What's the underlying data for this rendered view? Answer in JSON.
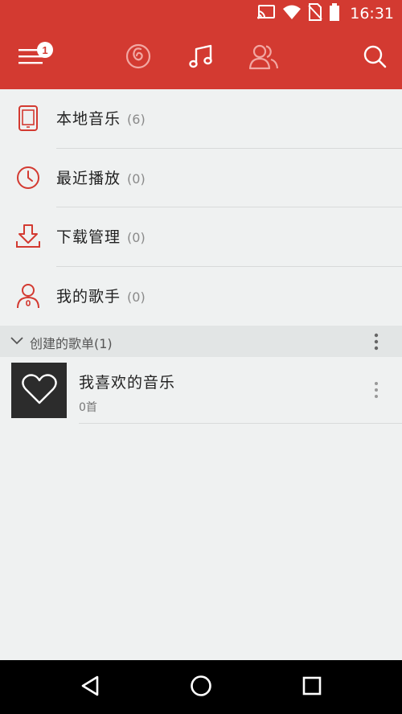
{
  "status_bar": {
    "time": "16:31",
    "icons": [
      "cast-icon",
      "wifi-icon",
      "no-sim-icon",
      "battery-icon"
    ]
  },
  "toolbar": {
    "menu_badge": "1",
    "tabs": [
      "netease-music-logo-icon",
      "music-note-icon",
      "friends-icon"
    ],
    "active_tab": "music-note-icon",
    "colors": {
      "bar": "#d33a31",
      "icon": "#ffffff",
      "icon_dim": "#f2a7a2"
    }
  },
  "menu": [
    {
      "icon": "phone-icon",
      "label": "本地音乐",
      "count": "(6)"
    },
    {
      "icon": "clock-icon",
      "label": "最近播放",
      "count": "(0)"
    },
    {
      "icon": "download-icon",
      "label": "下载管理",
      "count": "(0)"
    },
    {
      "icon": "singer-icon",
      "label": "我的歌手",
      "count": "(0)"
    }
  ],
  "section": {
    "title": "创建的歌单(1)"
  },
  "playlists": [
    {
      "icon": "heart-icon",
      "title": "我喜欢的音乐",
      "subtitle": "0首"
    }
  ],
  "accent_color": "#d33a31"
}
